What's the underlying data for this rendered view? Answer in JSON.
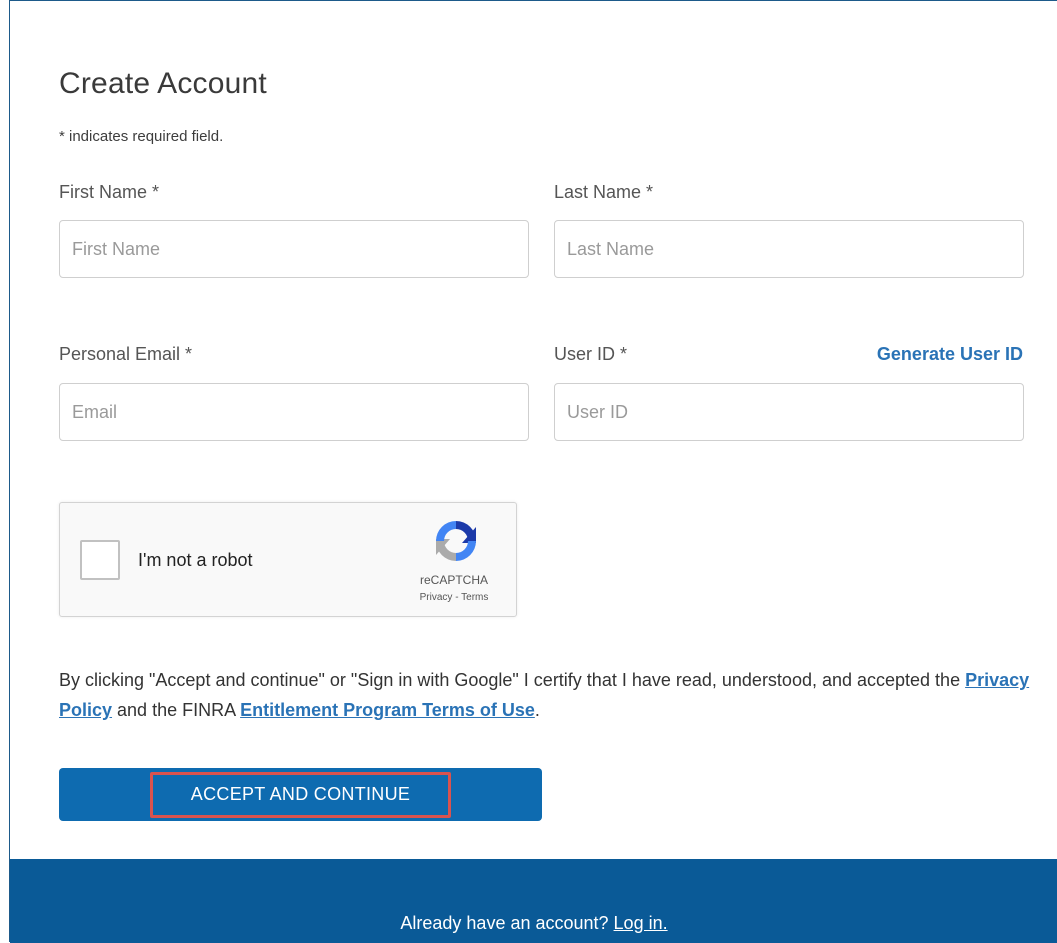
{
  "form": {
    "title": "Create Account",
    "required_note": "* indicates required field.",
    "first_name": {
      "label": "First Name *",
      "placeholder": "First Name",
      "value": ""
    },
    "last_name": {
      "label": "Last Name *",
      "placeholder": "Last Name",
      "value": ""
    },
    "email": {
      "label": "Personal Email *",
      "placeholder": "Email",
      "value": ""
    },
    "user_id": {
      "label": "User ID *",
      "placeholder": "User ID",
      "value": "",
      "generate_link": "Generate User ID"
    }
  },
  "captcha": {
    "label": "I'm not a robot",
    "brand": "reCAPTCHA",
    "privacy": "Privacy",
    "separator": " - ",
    "terms": "Terms",
    "icon": "recaptcha-logo-icon",
    "checked": false
  },
  "consent": {
    "text_before": "By clicking \"Accept and continue\" or \"Sign in with Google\" I certify that I have read, understood, and accepted the ",
    "privacy_link": "Privacy Policy",
    "text_middle": " and the FINRA ",
    "terms_link": "Entitlement Program Terms of Use",
    "text_after": "."
  },
  "actions": {
    "accept_label": "ACCEPT AND CONTINUE"
  },
  "footer": {
    "prompt": "Already have an account? ",
    "login_link": "Log in."
  },
  "colors": {
    "accent": "#0e6bb0",
    "link": "#2a73b6",
    "footer_bg": "#0a5a97",
    "highlight": "#d9534f"
  }
}
